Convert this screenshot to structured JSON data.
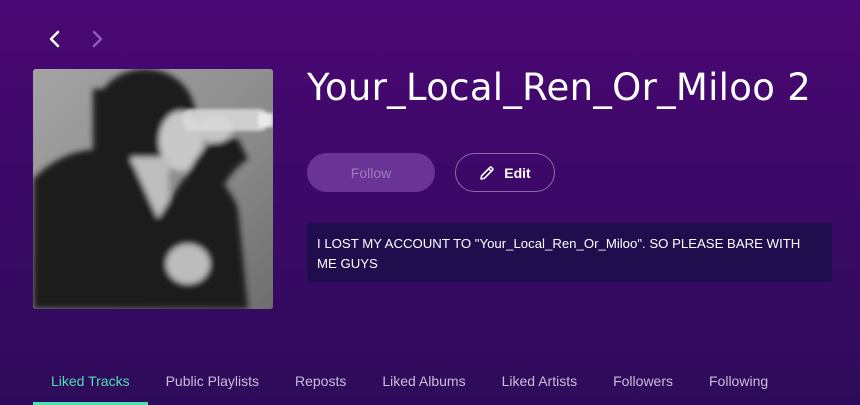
{
  "navigation": {
    "back_icon": "chevron-left-icon",
    "forward_icon": "chevron-right-icon"
  },
  "profile": {
    "name": "Your_Local_Ren_Or_Miloo 2",
    "avatar_description": "grayscale photo of a person drinking from a bottle",
    "follow_label": "Follow",
    "edit_label": "Edit",
    "edit_icon": "pencil-icon",
    "bio": "I LOST MY ACCOUNT TO \"Your_Local_Ren_Or_Miloo\". SO PLEASE BARE WITH ME GUYS"
  },
  "tabs": [
    {
      "label": "Liked Tracks",
      "active": true
    },
    {
      "label": "Public Playlists",
      "active": false
    },
    {
      "label": "Reposts",
      "active": false
    },
    {
      "label": "Liked Albums",
      "active": false
    },
    {
      "label": "Liked Artists",
      "active": false
    },
    {
      "label": "Followers",
      "active": false
    },
    {
      "label": "Following",
      "active": false
    }
  ],
  "colors": {
    "background_top": "#4a0874",
    "background_bottom": "#2e0b5a",
    "accent": "#4fe0b4",
    "bio_background": "#1f0d4d",
    "follow_button": "#6a3496"
  }
}
